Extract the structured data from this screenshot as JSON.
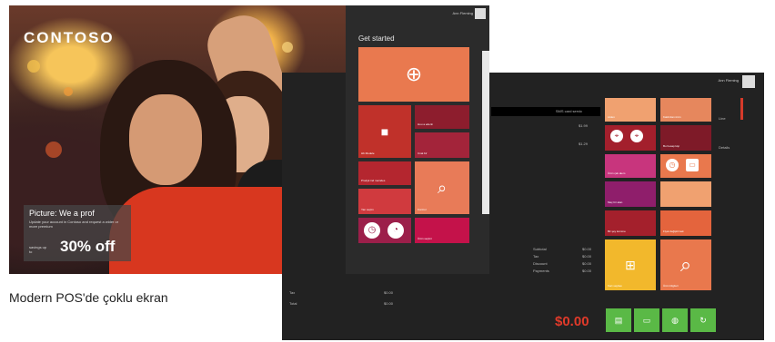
{
  "customer_display": {
    "logo": "CONTOSO",
    "promo": {
      "title": "Picture: We a prof",
      "subtitle": "Update your account in Contoso and request a wider or more premium",
      "save_label": "savings up to",
      "offer": "30% off"
    }
  },
  "caption": "Modern POS'de çoklu ekran",
  "pos_start": {
    "user_name": "Ann Fleming",
    "title": "Get started",
    "tiles": [
      {
        "label": "",
        "icon": "cart-plus-icon",
        "color": "#e9794f"
      },
      {
        "label": "Hb Modele",
        "icon": "lock-icon",
        "color": "#c0312a"
      },
      {
        "label": "Hou a ederin",
        "icon": "",
        "color": "#8d1d2d"
      },
      {
        "label": "Cnat bir",
        "icon": "",
        "color": "#a3243a"
      },
      {
        "label": "Prodyk ind meindes",
        "icon": "",
        "color": "#b4262f"
      },
      {
        "label": "Kontrol",
        "icon": "tag-search-icon",
        "color": "#e87b58"
      },
      {
        "label": "Yan seçim",
        "icon": "",
        "color": "#d03a3e"
      },
      {
        "label": "Ürün seçimi",
        "icon": "",
        "color": "#c4124a"
      }
    ]
  },
  "pos_tx": {
    "user_name": "Ann Fleming",
    "header_text": "SMS card servic",
    "lines": [
      {
        "amount": "$1.99"
      },
      {
        "amount": "$1.29"
      }
    ],
    "summary": [
      {
        "label": "Subtotal",
        "value": "$0.00"
      },
      {
        "label": "Tax",
        "value": "$0.00"
      },
      {
        "label": "Discount",
        "value": "$0.00"
      },
      {
        "label": "Payments",
        "value": "$0.00"
      }
    ],
    "side_labels": [
      "Line",
      "Details"
    ],
    "footer_labels": [
      "Tax",
      "Total"
    ],
    "total": "$0.00",
    "tiles": [
      {
        "label": "Liklen",
        "color": "#f0a170"
      },
      {
        "label": "Kaldırılan ürün",
        "color": "#e6875d"
      },
      {
        "label": "",
        "color": "#a31f2c"
      },
      {
        "label": "Bu hesap kişi",
        "color": "#7e1a28"
      },
      {
        "label": "Ürün çek alem",
        "color": "#c8357d"
      },
      {
        "label": "",
        "color": "#e9784d"
      },
      {
        "label": "Meç bir alan",
        "color": "#8f1e6b"
      },
      {
        "label": "",
        "color": "#f0a170"
      },
      {
        "label": "Bir şey komme",
        "color": "#a4202c"
      },
      {
        "label": "Fiyat değiştirmek",
        "color": "#e4643d"
      },
      {
        "label": "Kart sayfası",
        "color": "#f2b82c"
      },
      {
        "label": "Ürün bilgileri",
        "color": "#e9784d"
      }
    ],
    "payment_buttons": [
      "cash-icon",
      "card-icon",
      "bag-icon",
      "refresh-icon"
    ]
  }
}
